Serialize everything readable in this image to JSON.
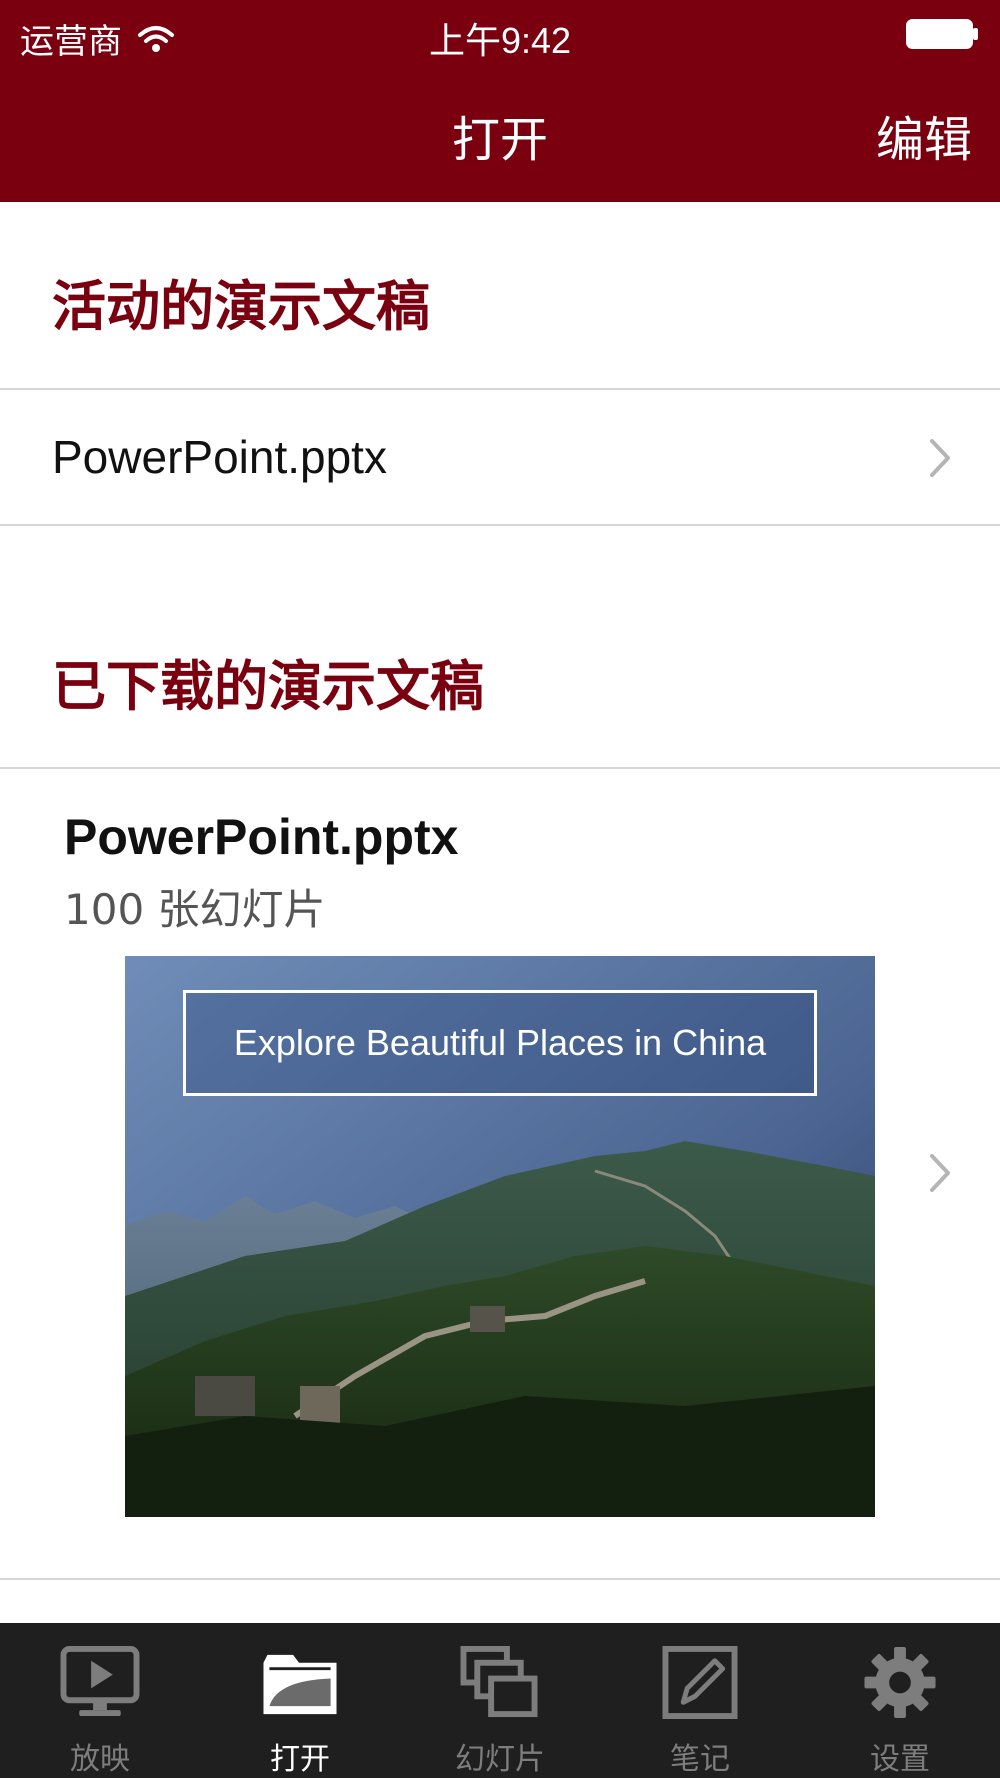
{
  "status_bar": {
    "carrier": "运营商",
    "time": "上午9:42"
  },
  "nav": {
    "title": "打开",
    "edit_label": "编辑"
  },
  "sections": {
    "active": {
      "header": "活动的演示文稿",
      "items": [
        {
          "label": "PowerPoint.pptx"
        }
      ]
    },
    "downloaded": {
      "header": "已下载的演示文稿",
      "items": [
        {
          "title": "PowerPoint.pptx",
          "subtitle": "100 张幻灯片",
          "thumbnail_caption": "Explore Beautiful Places in China"
        }
      ]
    }
  },
  "tabbar": {
    "items": [
      {
        "label": "放映",
        "icon": "play-monitor-icon",
        "active": false
      },
      {
        "label": "打开",
        "icon": "folder-icon",
        "active": true
      },
      {
        "label": "幻灯片",
        "icon": "slides-icon",
        "active": false
      },
      {
        "label": "笔记",
        "icon": "pencil-icon",
        "active": false
      },
      {
        "label": "设置",
        "icon": "gear-icon",
        "active": false
      }
    ]
  },
  "colors": {
    "brand": "#7a0010",
    "tabbar_bg": "#1f1f1f",
    "inactive_tab": "#7d7d7d"
  }
}
